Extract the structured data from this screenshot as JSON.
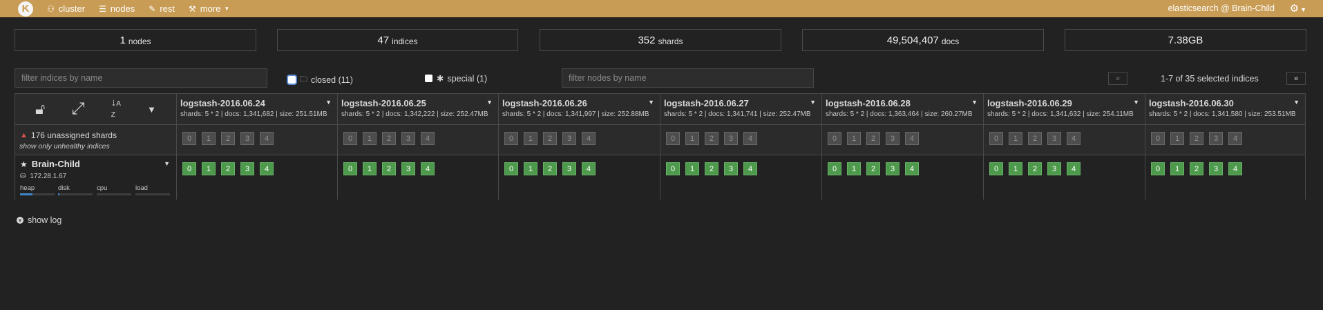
{
  "navbar": {
    "brand": "K",
    "items": [
      {
        "icon": "sitemap-icon",
        "glyph": "⚇",
        "label": "cluster"
      },
      {
        "icon": "list-icon",
        "glyph": "☰",
        "label": "nodes"
      },
      {
        "icon": "edit-icon",
        "glyph": "✎",
        "label": "rest"
      },
      {
        "icon": "wrench-icon",
        "glyph": "⚒",
        "label": "more"
      }
    ],
    "cluster_name": "elasticsearch @ Brain-Child"
  },
  "stats": [
    {
      "value": "1",
      "label": "nodes"
    },
    {
      "value": "47",
      "label": "indices"
    },
    {
      "value": "352",
      "label": "shards"
    },
    {
      "value": "49,504,407",
      "label": "docs"
    },
    {
      "value": "7.38GB",
      "label": ""
    }
  ],
  "filters": {
    "indices_placeholder": "filter indices by name",
    "closed_label": "closed (11)",
    "special_label": "special (1)",
    "nodes_placeholder": "filter nodes by name"
  },
  "pagination": {
    "prev": "«",
    "next": "»",
    "text": "1-7 of 35 selected indices"
  },
  "unassigned": {
    "text": "176 unassigned shards",
    "toggle": "show only unhealthy indices"
  },
  "indices": [
    {
      "name": "logstash-2016.06.24",
      "info": "shards: 5 * 2 | docs: 1,341,682 | size: 251.51MB"
    },
    {
      "name": "logstash-2016.06.25",
      "info": "shards: 5 * 2 | docs: 1,342,222 | size: 252.47MB"
    },
    {
      "name": "logstash-2016.06.26",
      "info": "shards: 5 * 2 | docs: 1,341,997 | size: 252.88MB"
    },
    {
      "name": "logstash-2016.06.27",
      "info": "shards: 5 * 2 | docs: 1,341,741 | size: 252.47MB"
    },
    {
      "name": "logstash-2016.06.28",
      "info": "shards: 5 * 2 | docs: 1,363,464 | size: 260.27MB"
    },
    {
      "name": "logstash-2016.06.29",
      "info": "shards: 5 * 2 | docs: 1,341,632 | size: 254.11MB"
    },
    {
      "name": "logstash-2016.06.30",
      "info": "shards: 5 * 2 | docs: 1,341,580 | size: 253.51MB"
    }
  ],
  "shard_numbers": [
    "0",
    "1",
    "2",
    "3",
    "4"
  ],
  "node": {
    "name": "Brain-Child",
    "ip": "172.28.1.67",
    "metrics": [
      {
        "label": "heap",
        "fill": 0.35
      },
      {
        "label": "disk",
        "fill": 0.03
      },
      {
        "label": "cpu",
        "fill": 0
      },
      {
        "label": "load",
        "fill": 0
      }
    ]
  },
  "show_log": "show log",
  "colors": {
    "navbar": "#c89c54",
    "shard_green": "#4e9a4c",
    "shard_grey": "#4d4d4d",
    "warning": "#d9534f",
    "metric_fill": "#3f86c8"
  }
}
